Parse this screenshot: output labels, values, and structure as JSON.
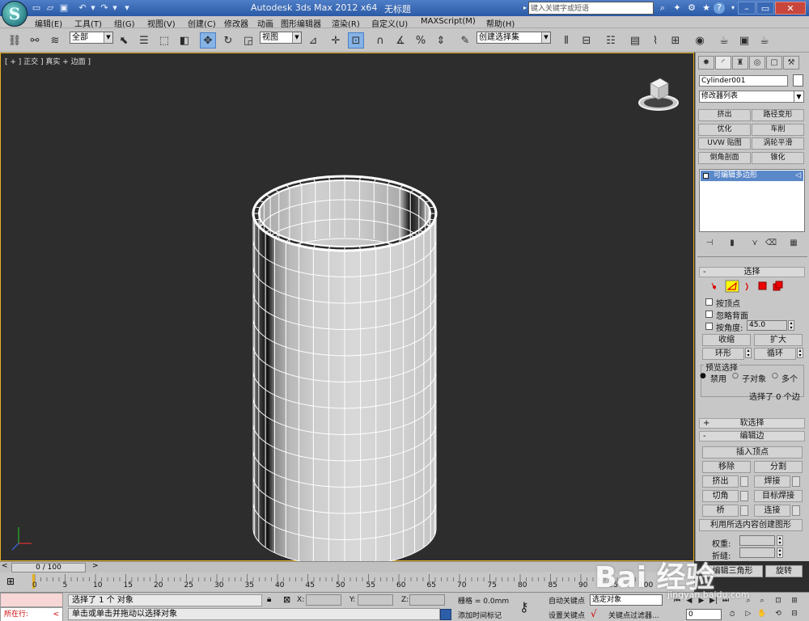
{
  "title_bar": {
    "app_title": "Autodesk 3ds Max  2012 x64",
    "file_name": "无标题",
    "search_placeholder": "键入关键字或短语",
    "quick_access": [
      "new-file",
      "open-file",
      "save-file",
      "undo",
      "redo"
    ]
  },
  "menu": {
    "items": [
      "编辑(E)",
      "工具(T)",
      "组(G)",
      "视图(V)",
      "创建(C)",
      "修改器",
      "动画",
      "图形编辑器",
      "渲染(R)",
      "自定义(U)",
      "MAXScript(M)",
      "帮助(H)"
    ]
  },
  "toolbar": {
    "selection_filter": "全部",
    "reference_coord": "视图",
    "named_selection": "创建选择集"
  },
  "viewport": {
    "label": "[ + ] 正交 ] 真实 + 边面 ]",
    "colors": {
      "border": "#e4b020",
      "background": "#2d2d2d",
      "mesh": "#ffffff"
    }
  },
  "command_panel": {
    "object_name": "Cylinder001",
    "modifier_list": "修改器列表",
    "modifier_buttons": [
      "挤出",
      "路径变形",
      "优化",
      "车削",
      "UVW 贴图",
      "涡轮平滑",
      "倒角剖面",
      "锥化"
    ],
    "stack_item": "可编辑多边形",
    "selection_rollout": {
      "title": "选择",
      "by_vertex": "按顶点",
      "ignore_backfacing": "忽略背面",
      "by_angle": "按角度:",
      "angle_value": "45.0",
      "shrink": "收缩",
      "grow": "扩大",
      "ring": "环形",
      "loop": "循环",
      "preview_title": "预览选择",
      "preview_options": [
        "禁用",
        "子对象",
        "多个"
      ],
      "status": "选择了 0 个边"
    },
    "soft_selection_title": "软选择",
    "edit_edges": {
      "title": "编辑边",
      "insert_vertex": "插入顶点",
      "remove": "移除",
      "split": "分割",
      "extrude": "挤出",
      "weld": "焊接",
      "chamfer": "切角",
      "target_weld": "目标焊接",
      "bridge": "桥",
      "connect": "连接",
      "create_shape": "利用所选内容创建图形",
      "weight": "权重:",
      "crease": "折缝:",
      "edit_tri": "编辑三角形",
      "turn": "旋转"
    }
  },
  "timeline": {
    "thumb": "0 / 100",
    "ticks": [
      "0",
      "5",
      "10",
      "15",
      "20",
      "25",
      "30",
      "35",
      "40",
      "45",
      "50",
      "55",
      "60",
      "65",
      "70",
      "75",
      "80",
      "85",
      "90",
      "95",
      "100"
    ]
  },
  "status_bar": {
    "listener": "所在行:",
    "line1": "选择了 1 个 对象",
    "line2": "单击或单击并拖动以选择对象",
    "x_label": "X:",
    "y_label": "Y:",
    "z_label": "Z:",
    "grid": "栅格 = 0.0mm",
    "add_time_tag": "添加时间标记",
    "auto_key": "自动关键点",
    "set_key": "设置关键点",
    "selected_object": "选定对象",
    "key_filters": "关键点过滤器...",
    "frame": "0"
  },
  "watermark": {
    "brand": "Bai 经验",
    "url": "jingyan.baidu.com"
  }
}
